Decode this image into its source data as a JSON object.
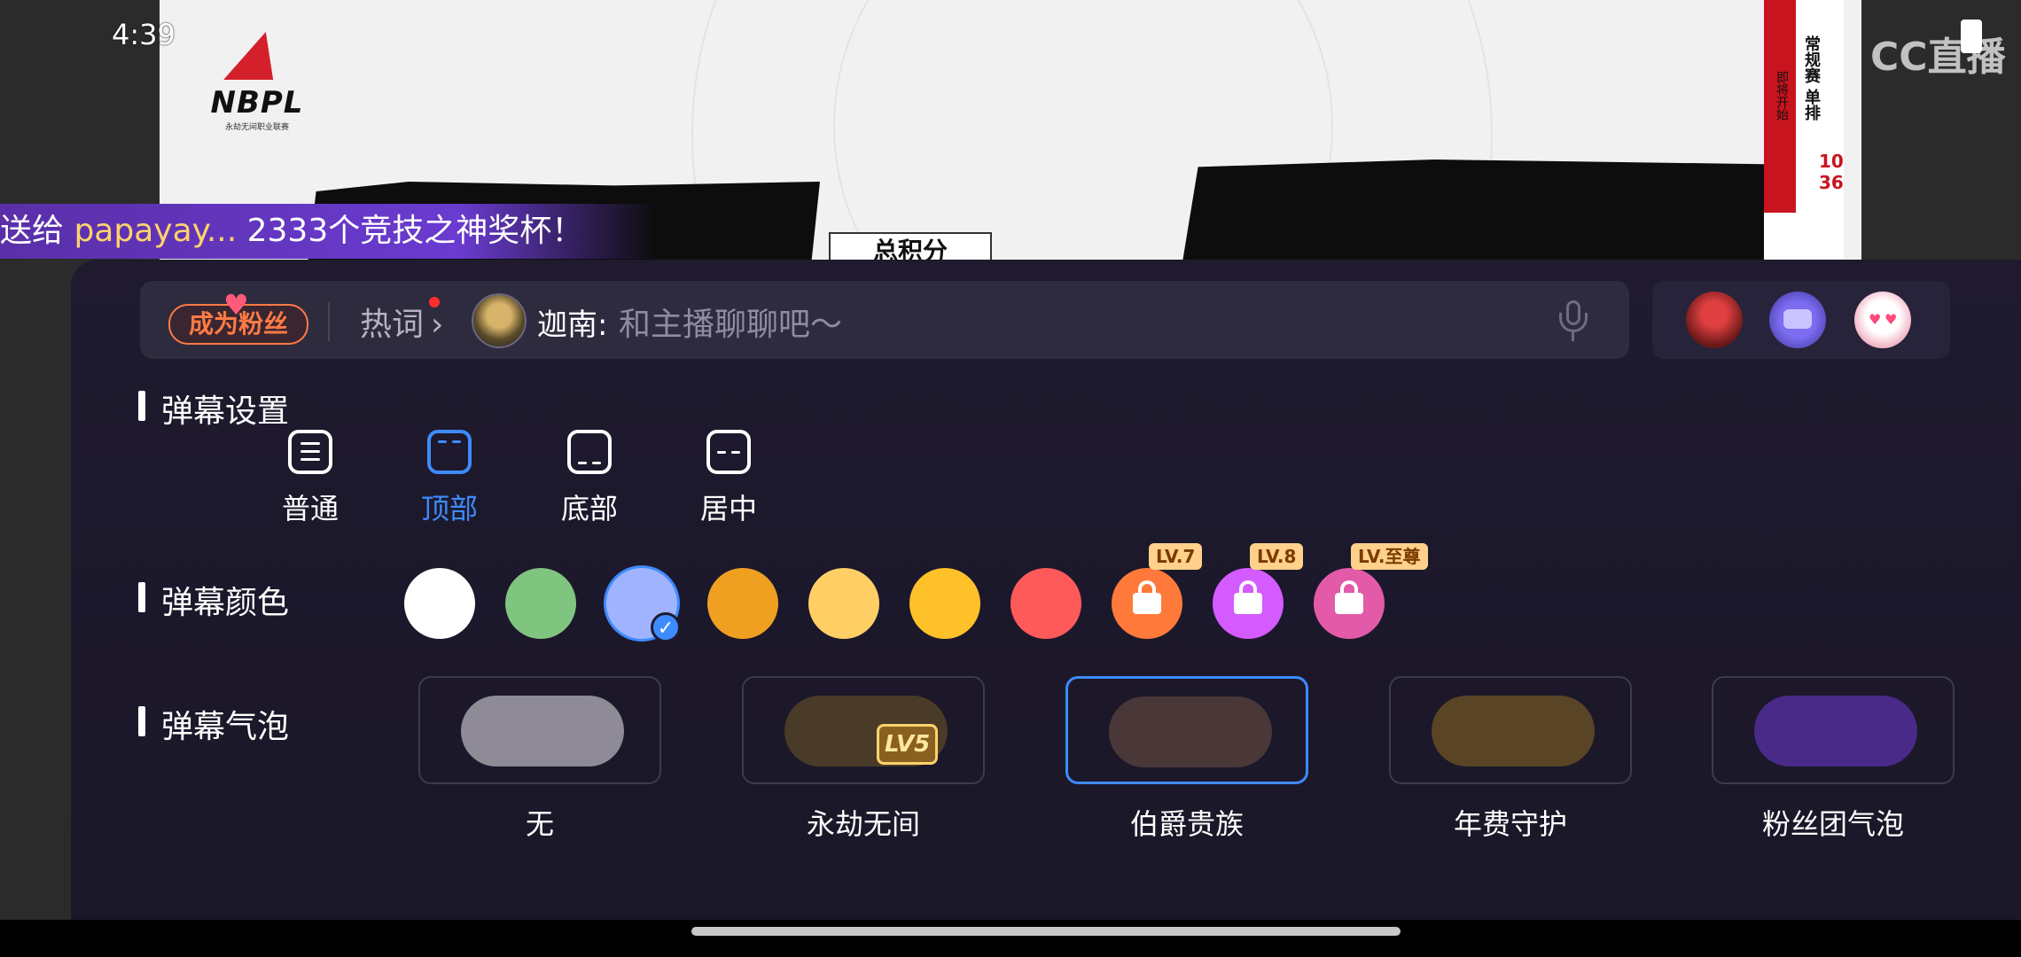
{
  "status": {
    "time": "4:39"
  },
  "video": {
    "league_logo_text": "NBPL",
    "league_sub_text": "永劫无间职业联赛",
    "score_label": "总积分",
    "side_banner_title": "常规赛 单排",
    "side_banner_sub": "即将开始",
    "side_banner_nums": "10\n36",
    "platform_logo": "CC直播"
  },
  "ticker": {
    "prefix": "送给 ",
    "name": "papayay...",
    "suffix": " 2333个竞技之神奖杯！"
  },
  "input_bar": {
    "fan_badge": "成为粉丝",
    "hotword": "热词",
    "user_name": "迦南:",
    "placeholder": "和主播聊聊吧～"
  },
  "sections": {
    "mode_title": "弹幕设置",
    "color_title": "弹幕颜色",
    "bubble_title": "弹幕气泡"
  },
  "modes": [
    {
      "label": "普通",
      "active": false
    },
    {
      "label": "顶部",
      "active": true
    },
    {
      "label": "底部",
      "active": false
    },
    {
      "label": "居中",
      "active": false
    }
  ],
  "colors": [
    {
      "hex": "#ffffff"
    },
    {
      "hex": "#7fc47f"
    },
    {
      "hex": "#9fb3ff",
      "selected": true
    },
    {
      "hex": "#f0a020"
    },
    {
      "hex": "#ffcf66"
    },
    {
      "hex": "#ffc12a"
    },
    {
      "hex": "#ff5a5a"
    },
    {
      "hex": "#ff7a3a",
      "locked": true,
      "level": "LV.7"
    },
    {
      "hex": "#d35bff",
      "locked": true,
      "level": "LV.8"
    },
    {
      "hex": "#e35aa8",
      "locked": true,
      "level": "LV.至尊"
    }
  ],
  "bubbles": [
    {
      "label": "无",
      "color": "#8e8b97",
      "selected": false
    },
    {
      "label": "永劫无间",
      "color": "#4a3a28",
      "selected": false,
      "tag": "LV5"
    },
    {
      "label": "伯爵贵族",
      "color": "#4a3838",
      "selected": true
    },
    {
      "label": "年费守护",
      "color": "#5a4426",
      "selected": false
    },
    {
      "label": "粉丝团气泡",
      "color": "#4a2a88",
      "selected": false
    }
  ],
  "accent": "#3d8bff"
}
